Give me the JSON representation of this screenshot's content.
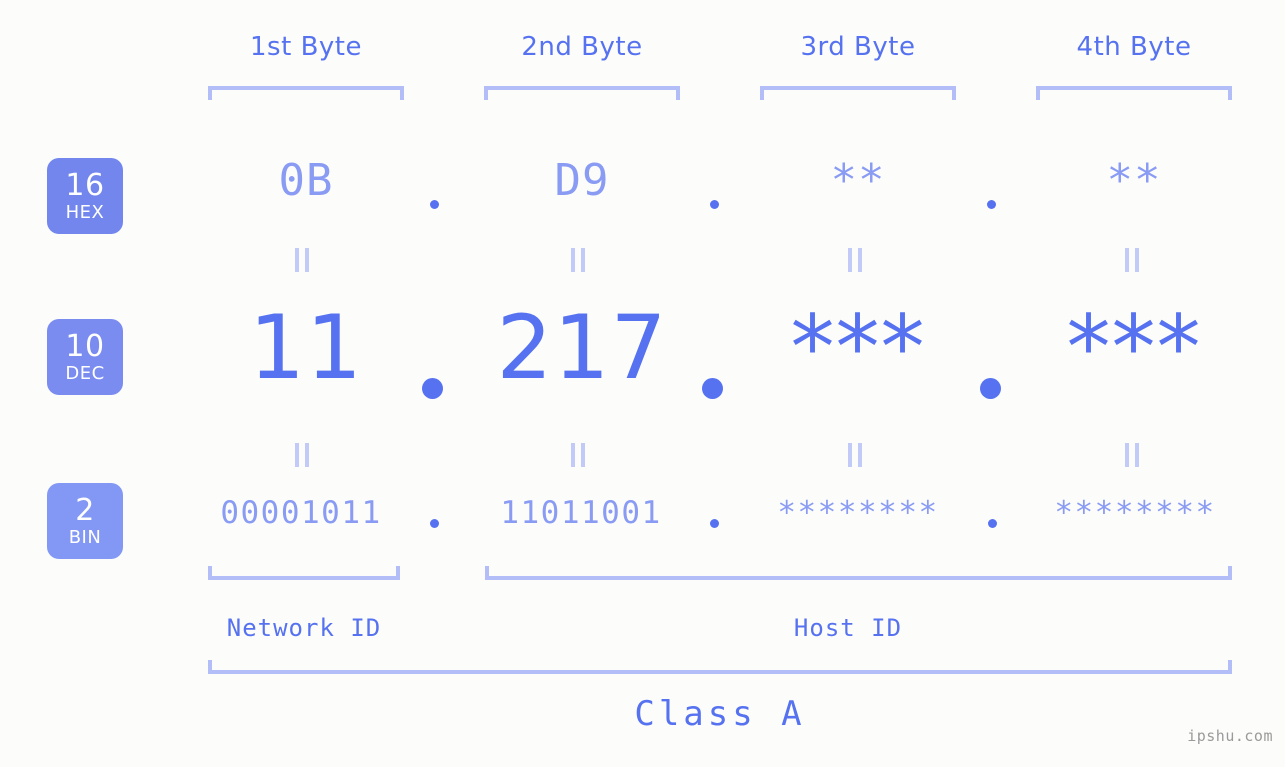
{
  "background_color": "#fcfdfa",
  "accent_color": "#5672f0",
  "accent_light_color": "#8a9bf4",
  "bracket_color": "#b3bdf7",
  "badge_color": "#7286ee",
  "byte_headers": [
    {
      "label": "1st Byte"
    },
    {
      "label": "2nd Byte"
    },
    {
      "label": "3rd Byte"
    },
    {
      "label": "4th Byte"
    }
  ],
  "bases": [
    {
      "num": "16",
      "tag": "HEX"
    },
    {
      "num": "10",
      "tag": "DEC"
    },
    {
      "num": "2",
      "tag": "BIN"
    }
  ],
  "rows": {
    "hex": {
      "base_num": "16",
      "base_tag": "HEX",
      "values": [
        "0B",
        "D9",
        "**",
        "**"
      ]
    },
    "dec": {
      "base_num": "10",
      "base_tag": "DEC",
      "values": [
        "11",
        "217",
        "***",
        "***"
      ]
    },
    "bin": {
      "base_num": "2",
      "base_tag": "BIN",
      "values": [
        "00001011",
        "11011001",
        "********",
        "********"
      ]
    }
  },
  "separators": {
    "dot": "."
  },
  "id_labels": {
    "network": "Network ID",
    "host": "Host ID"
  },
  "class_label": "Class A",
  "watermark": "ipshu.com"
}
